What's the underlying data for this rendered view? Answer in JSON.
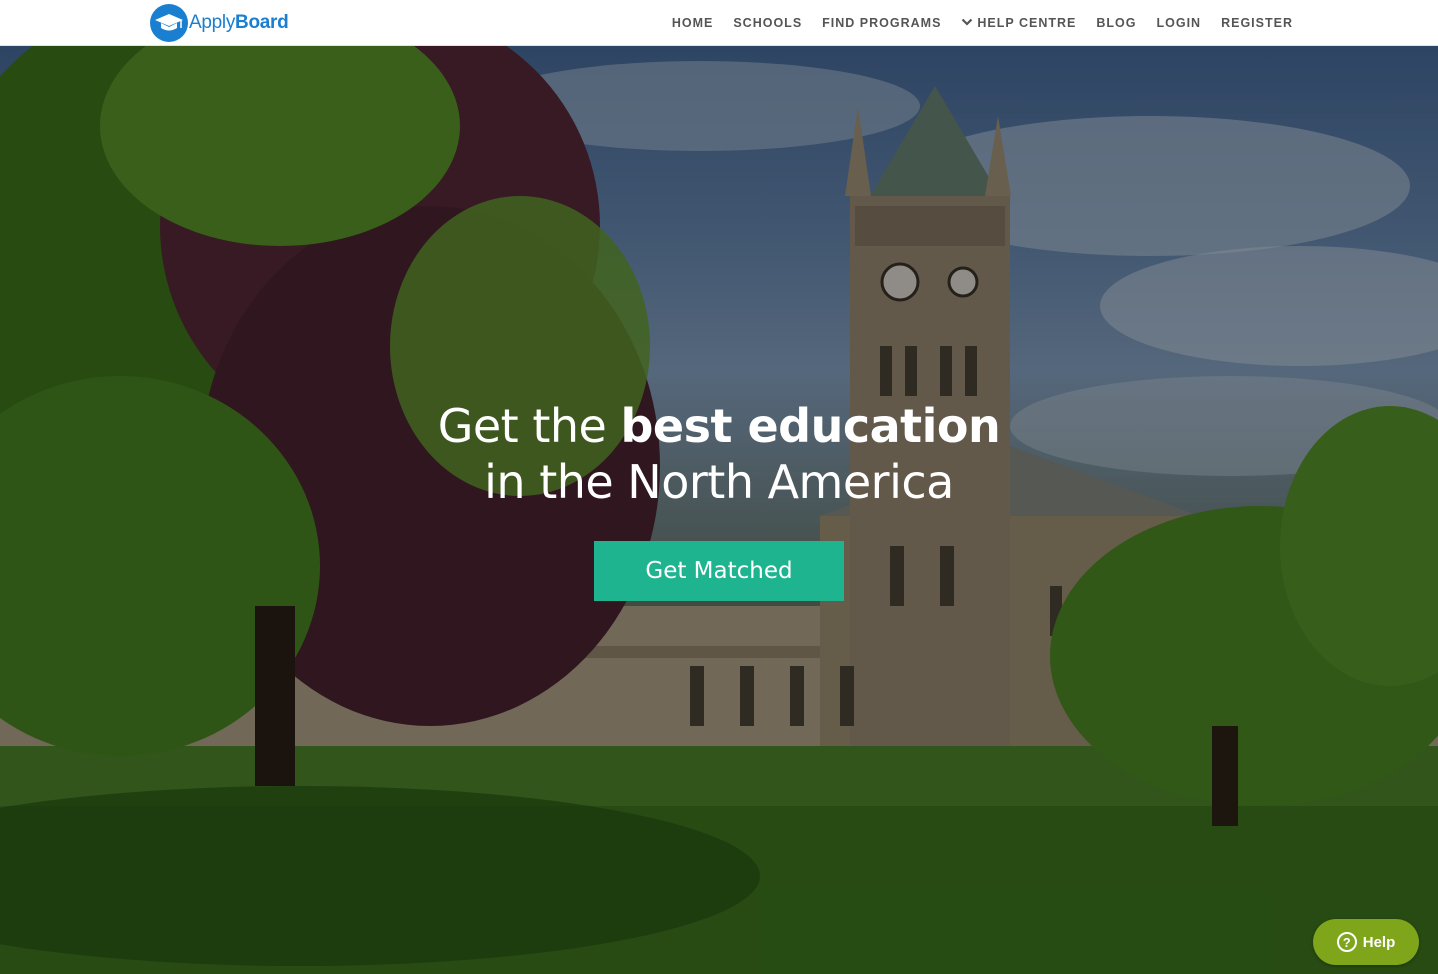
{
  "header": {
    "logo_text_bold": "Apply",
    "logo_text_rest": "Board",
    "nav": [
      {
        "label": "HOME"
      },
      {
        "label": "SCHOOLS"
      },
      {
        "label": "FIND PROGRAMS"
      },
      {
        "label": "HELP CENTRE",
        "icon": "chevron-down-icon"
      },
      {
        "label": "BLOG"
      },
      {
        "label": "LOGIN"
      },
      {
        "label": "REGISTER"
      }
    ]
  },
  "hero": {
    "headline_prefix": "Get the ",
    "headline_bold": "best education",
    "headline_line2": "in the North America",
    "cta_label": "Get Matched"
  },
  "help_widget": {
    "label": "Help",
    "icon": "question-icon"
  },
  "colors": {
    "brand_blue": "#1a7fd0",
    "cta_teal": "#1fb490",
    "help_green": "#7fa51a"
  }
}
